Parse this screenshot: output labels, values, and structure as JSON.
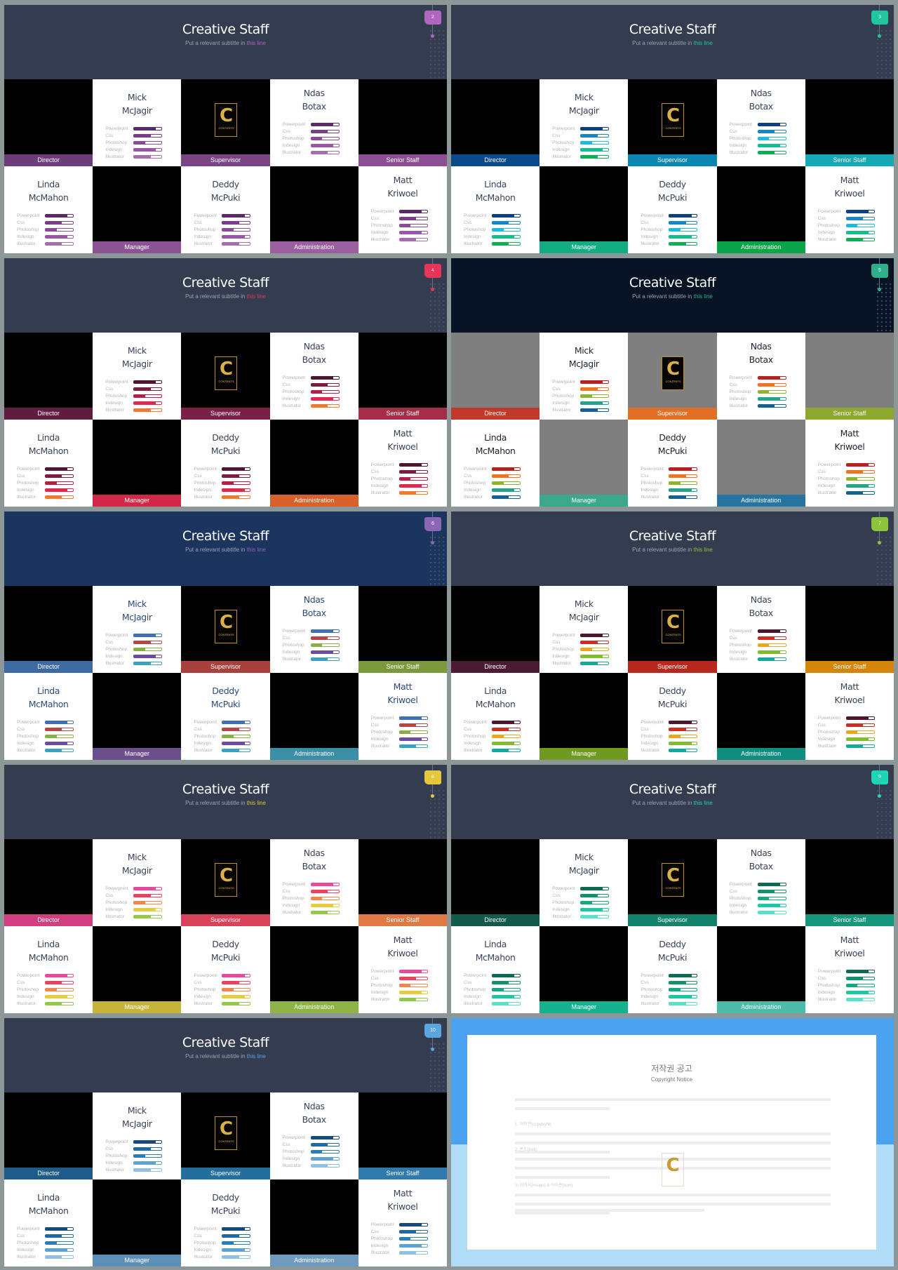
{
  "slide_template": {
    "title": "Creative Staff",
    "subtitle_prefix": "Put a relevant subtitle in ",
    "subtitle_highlight": "this line",
    "logo_text": "CONTENTS",
    "roles": [
      "Director",
      "Supervisor",
      "Senior Staff",
      "Manager",
      "Administration"
    ],
    "people": [
      {
        "first": "Mick",
        "last": "McJagir"
      },
      {
        "first": "Ndas",
        "last": "Botax"
      },
      {
        "first": "Linda",
        "last": "McMahon"
      },
      {
        "first": "Deddy",
        "last": "McPuki"
      },
      {
        "first": "Matt",
        "last": "Kriwoel"
      }
    ],
    "skills": [
      {
        "label": "Powerpoint",
        "percent": 80
      },
      {
        "label": "Css",
        "percent": 60
      },
      {
        "label": "Photoshop",
        "percent": 40
      },
      {
        "label": "Indesign",
        "percent": 80
      },
      {
        "label": "Illustrator",
        "percent": 60
      }
    ]
  },
  "slides": [
    {
      "number": "2",
      "header_bg": "#343d4f",
      "accent": "#b164c0",
      "photo_bg": "#000000",
      "name_color": "#3a4457",
      "role_colors": [
        "#6d3c7a",
        "#7b4585",
        "#8c4f94",
        "#8b5394",
        "#9a5ea1"
      ],
      "bar_colors": [
        "#5a2a66",
        "#7a3c88",
        "#8b4a99",
        "#9a55a6",
        "#a86bb2"
      ]
    },
    {
      "number": "3",
      "header_bg": "#343d4f",
      "accent": "#1fc7a0",
      "photo_bg": "#000000",
      "name_color": "#3a4457",
      "role_colors": [
        "#0a4a8a",
        "#0a86b0",
        "#14a9b5",
        "#12ad82",
        "#0aa548"
      ],
      "bar_colors": [
        "#0a3f86",
        "#1685c8",
        "#16bde0",
        "#12be8a",
        "#0ab04e"
      ]
    },
    {
      "number": "4",
      "header_bg": "#343d4f",
      "accent": "#e8345a",
      "photo_bg": "#000000",
      "name_color": "#3a4457",
      "role_colors": [
        "#5e1d3e",
        "#7a2044",
        "#a52d4a",
        "#d22848",
        "#d8612a"
      ],
      "bar_colors": [
        "#4e1634",
        "#7a1d40",
        "#b32046",
        "#e0284e",
        "#ee7a30"
      ]
    },
    {
      "number": "5",
      "header_bg": "#061426",
      "accent": "#2fae8a",
      "photo_bg": "#7f7f7f",
      "name_color": "#1d2430",
      "role_colors": [
        "#c0392b",
        "#e36f26",
        "#8ca82e",
        "#3aa88a",
        "#2675a0"
      ],
      "bar_colors": [
        "#b52020",
        "#ef7420",
        "#8db42a",
        "#26a28a",
        "#16608e"
      ]
    },
    {
      "number": "6",
      "header_bg": "#1c355e",
      "accent": "#8a66b4",
      "photo_bg": "#000000",
      "name_color": "#2c4a78",
      "role_colors": [
        "#3e6aa4",
        "#a8403c",
        "#7b9a3c",
        "#6a4f8c",
        "#3a8ea6"
      ],
      "bar_colors": [
        "#3f6fb4",
        "#b94444",
        "#86b142",
        "#6c4c9e",
        "#3aa2be"
      ]
    },
    {
      "number": "7",
      "header_bg": "#343d4f",
      "accent": "#8cc43c",
      "photo_bg": "#000000",
      "name_color": "#3a4457",
      "role_colors": [
        "#4a1c33",
        "#b8281c",
        "#d6850c",
        "#6f9a1f",
        "#0f8e80"
      ],
      "bar_colors": [
        "#4a1630",
        "#d02a22",
        "#f0a41a",
        "#80bc2c",
        "#12aa98"
      ]
    },
    {
      "number": "8",
      "header_bg": "#343d4f",
      "accent": "#e6c63a",
      "photo_bg": "#000000",
      "name_color": "#3a4457",
      "role_colors": [
        "#d0407e",
        "#d9435a",
        "#df7a44",
        "#c6b43a",
        "#8db444"
      ],
      "bar_colors": [
        "#e64a9a",
        "#ea4260",
        "#f0864a",
        "#e4cc3c",
        "#94c84a"
      ]
    },
    {
      "number": "9",
      "header_bg": "#343d4f",
      "accent": "#1fd6b4",
      "photo_bg": "#000000",
      "name_color": "#3a4457",
      "role_colors": [
        "#135a48",
        "#12826a",
        "#16977a",
        "#16b290",
        "#4cbca8"
      ],
      "bar_colors": [
        "#0e6a52",
        "#12906e",
        "#14a882",
        "#1cc8a4",
        "#5ae0c8"
      ]
    },
    {
      "number": "10",
      "header_bg": "#343d4f",
      "accent": "#5aa6e0",
      "photo_bg": "#000000",
      "name_color": "#3a4457",
      "role_colors": [
        "#1e5b88",
        "#246e9e",
        "#3079ac",
        "#5c90b8",
        "#6f9bbe"
      ],
      "bar_colors": [
        "#174a7a",
        "#2068a4",
        "#2a7cbc",
        "#5ea2d4",
        "#8ec0e4"
      ]
    }
  ],
  "copyright": {
    "title": "저작권 공고",
    "subtitle": "Copyright Notice",
    "sections": [
      "",
      "1. 저작권(copyright)",
      "2. 폰트(font)",
      "3. 이미지(image) & 아이콘(icon)",
      ""
    ],
    "logo_text": "C",
    "colors": {
      "top": "#4aa2f1",
      "bottom": "#b1dcf8"
    }
  }
}
